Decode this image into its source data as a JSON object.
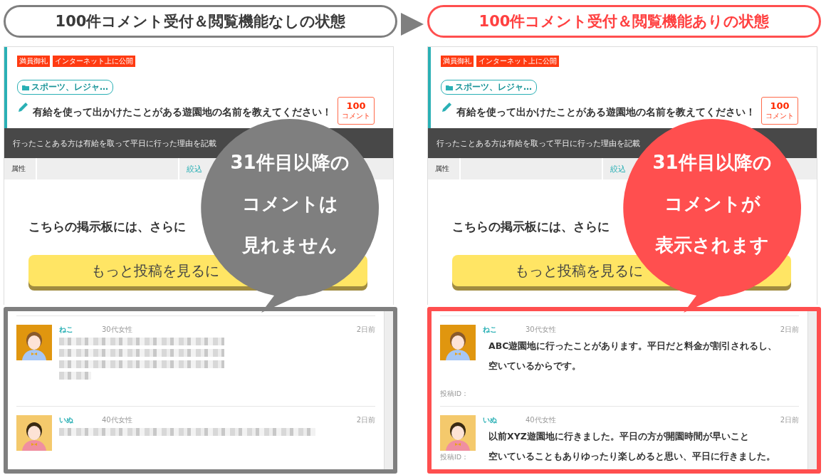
{
  "panels": [
    {
      "heading": "100件コメント受付＆閲覧機能なしの状態",
      "tags": [
        "満員御礼",
        "インターネット上に公開"
      ],
      "category": "スポーツ、レジャ…",
      "question": "有給を使って出かけたことがある遊園地の名前を教えてください！",
      "comment_count": "100",
      "comment_label": "コメント",
      "description": "行ったことある方は有給を取って平日に行った理由を記載",
      "filter_label": "属性",
      "narrow_label": "絞込",
      "notice": "こちらの掲示板には、さらに",
      "more_button": "もっと投稿を見るに",
      "callout": [
        "31件目以降の",
        "コメントは",
        "見れません"
      ],
      "comments": [
        {
          "kind": "blurred",
          "name": "ねこ",
          "attribute": "30代女性",
          "time": "2日前"
        },
        {
          "kind": "blurred",
          "name": "いぬ",
          "attribute": "40代女性",
          "time": "2日前"
        }
      ]
    },
    {
      "heading": "100件コメント受付＆閲覧機能ありの状態",
      "tags": [
        "満員御礼",
        "インターネット上に公開"
      ],
      "category": "スポーツ、レジャ…",
      "question": "有給を使って出かけたことがある遊園地の名前を教えてください！",
      "comment_count": "100",
      "comment_label": "コメント",
      "description": "行ったことある方は有給を取って平日に行った理由を記載",
      "filter_label": "属性",
      "narrow_label": "絞込",
      "notice": "こちらの掲示板には、さらに",
      "more_button": "もっと投稿を見るに",
      "callout": [
        "31件目以降の",
        "コメントが",
        "表示されます"
      ],
      "comments": [
        {
          "kind": "text",
          "name": "ねこ",
          "attribute": "30代女性",
          "time": "2日前",
          "text": [
            "ABC遊園地に行ったことがあります。平日だと料金が割引されるし、",
            "空いているからです。"
          ],
          "post_id": "投稿ID："
        },
        {
          "kind": "text",
          "name": "いぬ",
          "attribute": "40代女性",
          "time": "2日前",
          "text": [
            "以前XYZ遊園地に行きました。平日の方が開園時間が早いこと",
            "空いていることもありゆったり楽しめると思い、平日に行きました。"
          ],
          "post_id": "投稿ID："
        }
      ]
    }
  ]
}
